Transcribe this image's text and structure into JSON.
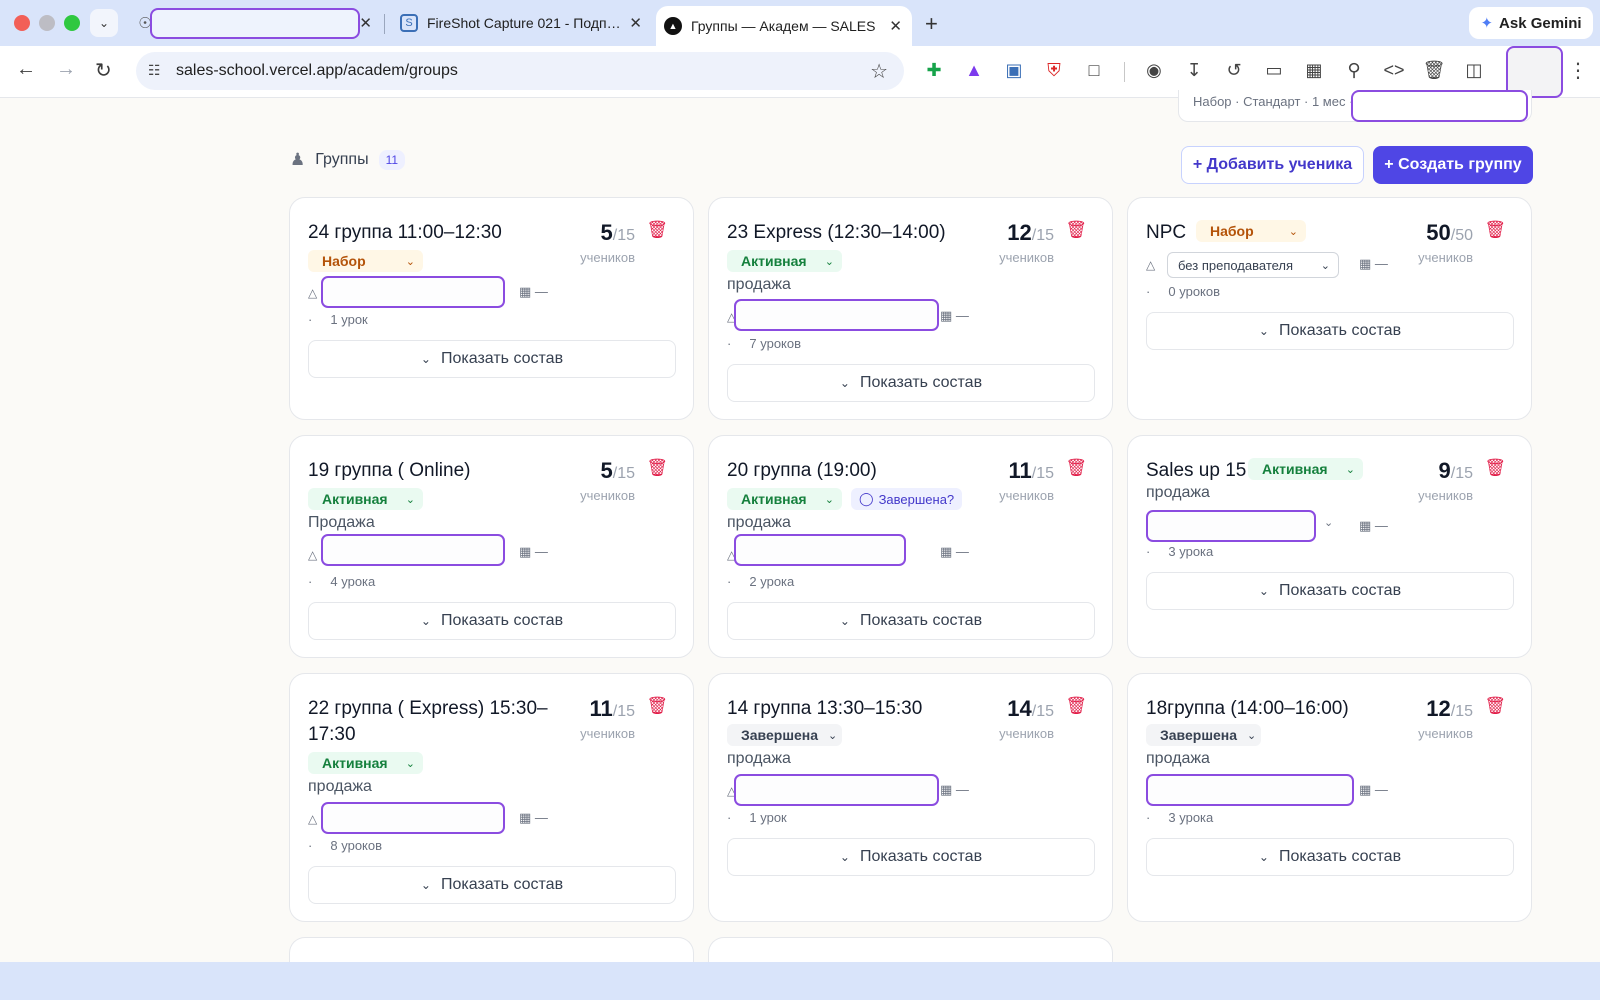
{
  "browser": {
    "tabs": [
      {
        "title": "",
        "active": false
      },
      {
        "title": "FireShot Capture 021 - Подп…",
        "active": false
      },
      {
        "title": "Группы — Академ — SALES U",
        "active": true
      }
    ],
    "url": "sales-school.vercel.app/academ/groups",
    "ask_gemini": "Ask Gemini"
  },
  "page": {
    "top_peek_text": "Набор · Стандарт · 1 мес ·",
    "section_title": "Группы",
    "group_count": "11",
    "add_student_label": "+ Добавить ученика",
    "create_group_label": "+ Создать группу",
    "students_label": "учеников",
    "show_members_label": "Показать состав",
    "colors": {
      "accent": "#4f46e5",
      "danger": "#e11d48",
      "redaction": "#8b4ce0"
    },
    "groups": [
      {
        "title": "24 группа 11:00–12:30",
        "status": "Набор",
        "count": "5",
        "cap": "/15",
        "product": "",
        "dates": "—",
        "lessons": "1 урок"
      },
      {
        "title": "23 Express (12:30–14:00)",
        "status": "Активная",
        "count": "12",
        "cap": "/15",
        "product": "продажа",
        "dates": "—",
        "lessons": "7 уроков"
      },
      {
        "title": "NPC",
        "status": "Набор",
        "count": "50",
        "cap": "/50",
        "product": "",
        "teacher": "без преподавателя",
        "dates": "—",
        "lessons": "0 уроков"
      },
      {
        "title": "19 группа ( Online)",
        "status": "Активная",
        "count": "5",
        "cap": "/15",
        "product": "Продажа",
        "dates": "—",
        "lessons": "4 урока"
      },
      {
        "title": "20 группа (19:00)",
        "status": "Активная",
        "hint": "Завершена?",
        "count": "11",
        "cap": "/15",
        "product": "продажа",
        "dates": "—",
        "lessons": "2 урока"
      },
      {
        "title": "Sales up 15",
        "status": "Активная",
        "count": "9",
        "cap": "/15",
        "product": "продажа",
        "dates": "—",
        "lessons": "3 урока"
      },
      {
        "title": "22 группа ( Express) 15:30–17:30",
        "status": "Активная",
        "count": "11",
        "cap": "/15",
        "product": "продажа",
        "dates": "—",
        "lessons": "8 уроков"
      },
      {
        "title": "14 группа 13:30–15:30",
        "status": "Завершена",
        "count": "14",
        "cap": "/15",
        "product": "продажа",
        "dates": "—",
        "lessons": "1 урок"
      },
      {
        "title": "18группа (14:00–16:00)",
        "status": "Завершена",
        "count": "12",
        "cap": "/15",
        "product": "продажа",
        "dates": "—",
        "lessons": "3 урока"
      }
    ]
  }
}
